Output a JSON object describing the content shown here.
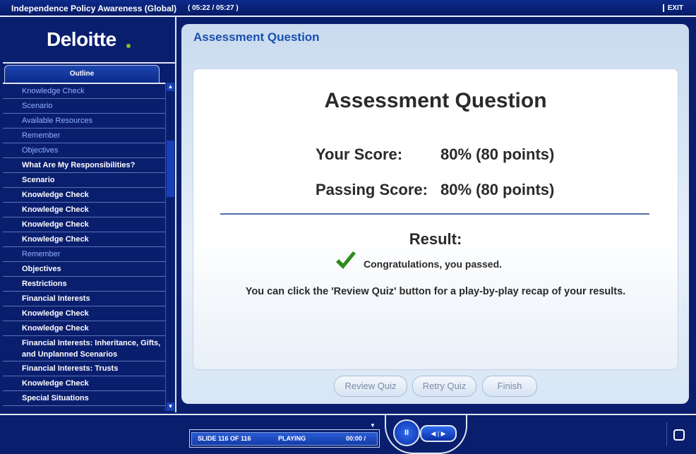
{
  "window": {
    "title": "Independence Policy Awareness (Global)",
    "time": "( 05:22 / 05:27 )",
    "exit": "EXIT"
  },
  "sidebar": {
    "logo": "Deloitte",
    "outline_tab": "Outline",
    "items": [
      {
        "label": "Knowledge Check",
        "state": "visited"
      },
      {
        "label": "Scenario",
        "state": "visited"
      },
      {
        "label": "Available Resources",
        "state": "visited"
      },
      {
        "label": "Remember",
        "state": "visited"
      },
      {
        "label": "Objectives",
        "state": "visited"
      },
      {
        "label": "What Are My Responsibilities?",
        "state": "current"
      },
      {
        "label": "Scenario",
        "state": "current"
      },
      {
        "label": "Knowledge Check",
        "state": "current"
      },
      {
        "label": "Knowledge Check",
        "state": "current"
      },
      {
        "label": "Knowledge Check",
        "state": "current"
      },
      {
        "label": "Knowledge Check",
        "state": "current"
      },
      {
        "label": "Remember",
        "state": "visited"
      },
      {
        "label": "Objectives",
        "state": "current"
      },
      {
        "label": "Restrictions",
        "state": "current"
      },
      {
        "label": "Financial Interests",
        "state": "current"
      },
      {
        "label": "Knowledge Check",
        "state": "current"
      },
      {
        "label": "Knowledge Check",
        "state": "current"
      },
      {
        "label": "Financial Interests: Inheritance, Gifts, and Unplanned Scenarios",
        "state": "current"
      },
      {
        "label": "Financial Interests: Trusts",
        "state": "current"
      },
      {
        "label": "Knowledge Check",
        "state": "current"
      },
      {
        "label": "Special Situations",
        "state": "current"
      }
    ]
  },
  "main": {
    "panel_title": "Assessment Question",
    "card_title": "Assessment Question",
    "your_score_label": "Your Score:",
    "your_score_value": "80% (80 points)",
    "passing_score_label": "Passing Score:",
    "passing_score_value": "80% (80 points)",
    "result_label": "Result:",
    "result_message": "Congratulations, you passed.",
    "info": "You can click the 'Review Quiz' button for a play-by-play recap of your results.",
    "buttons": {
      "review": "Review Quiz",
      "retry": "Retry Quiz",
      "finish": "Finish"
    }
  },
  "player": {
    "slide": "SLIDE 116 OF 116",
    "state": "PLAYING",
    "time": "00:00 /",
    "pause": "II",
    "skip": "◀ | ▶"
  },
  "colors": {
    "accent": "#1b4fae",
    "check": "#2e8b1f",
    "brand_dot": "#86bc25"
  }
}
